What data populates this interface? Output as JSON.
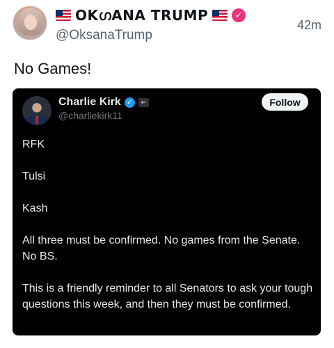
{
  "post": {
    "author_name": "OKഗANA TRUMP",
    "handle": "@OksanaTrump",
    "time": "42m",
    "text": "No Games!",
    "verified_color": "#e8337a"
  },
  "quoted": {
    "author_name": "Charlie Kirk",
    "handle": "@charliekirk11",
    "follow_label": "Follow",
    "verified_color": "#1d9bf0",
    "paragraphs": [
      "RFK",
      "Tulsi",
      "Kash",
      "All three must be confirmed. No games from the Senate. No BS.",
      "This is a friendly reminder to all Senators to ask your tough questions this week, and then they must be confirmed."
    ]
  },
  "icons": {
    "flag": "us-flag-icon",
    "verified": "verified-badge-icon",
    "affiliation": "affiliation-badge-icon"
  }
}
